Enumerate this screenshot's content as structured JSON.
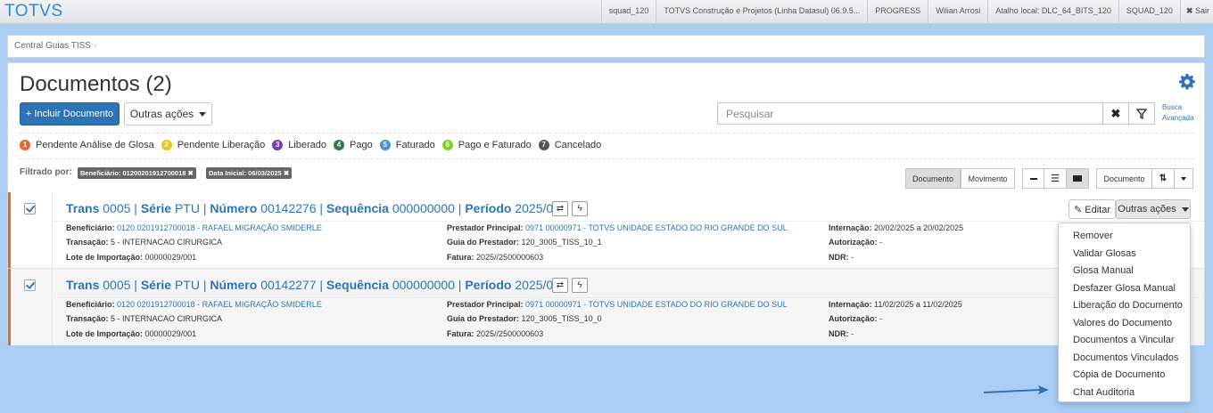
{
  "topbar": {
    "brand": "TOTVS",
    "items": [
      "squad_120",
      "TOTVS Construção e Projetos (Linha Datasul) 06.9.5...",
      "PROGRESS",
      "Wilian Arrosi",
      "Atalho local: DLC_64_BITS_120",
      "SQUAD_120"
    ],
    "exit": "Sair"
  },
  "breadcrumb": "Central Guias TISS",
  "page": {
    "title": "Documentos (2)",
    "add_button": "+ Incluir Documento",
    "other_actions": "Outras ações",
    "search_placeholder": "Pesquisar",
    "advanced_search_1": "Busca",
    "advanced_search_2": "Avançada"
  },
  "legend": [
    {
      "num": "1",
      "label": "Pendente Análise de Glosa",
      "color": "#e8642c"
    },
    {
      "num": "2",
      "label": "Pendente Liberação",
      "color": "#f0c419"
    },
    {
      "num": "3",
      "label": "Liberado",
      "color": "#7b3fa8"
    },
    {
      "num": "4",
      "label": "Pago",
      "color": "#2e7d4f"
    },
    {
      "num": "5",
      "label": "Faturado",
      "color": "#4a90e2"
    },
    {
      "num": "6",
      "label": "Pago e Faturado",
      "color": "#7ed321"
    },
    {
      "num": "7",
      "label": "Cancelado",
      "color": "#555555"
    }
  ],
  "filters": {
    "label": "Filtrado por:",
    "tags": [
      "Beneficiário: 01200201912700018",
      "Data Inicial: 06/03/2025"
    ]
  },
  "view": {
    "documento": "Documento",
    "movimento": "Movimento",
    "sort": "Documento"
  },
  "rows": [
    {
      "trans_k": "Trans",
      "trans_v": "0005",
      "serie_k": "Série",
      "serie_v": "PTU",
      "numero_k": "Número",
      "numero_v": "00142276",
      "seq_k": "Sequência",
      "seq_v": "000000000",
      "periodo_k": "Período",
      "periodo_v": "2025/003",
      "benef_k": "Beneficiário:",
      "benef_v": "0120 0201912700018 - RAFAEL MIGRAÇÃO SMIDERLE",
      "transacao_k": "Transação:",
      "transacao_v": "5 - INTERNACAO CIRURGICA",
      "lote_k": "Lote de Importação:",
      "lote_v": "00000029/001",
      "prest_k": "Prestador Principal:",
      "prest_v": "0971 00000971 - TOTVS UNIDADE ESTADO DO RIO GRANDE DO SUL",
      "guia_k": "Guia do Prestador:",
      "guia_v": "120_3005_TISS_10_1",
      "fatura_k": "Fatura:",
      "fatura_v": "2025//2500000603",
      "intern_k": "Internação:",
      "intern_v": "20/02/2025 a 20/02/2025",
      "autor_k": "Autorização:",
      "autor_v": "-",
      "ndr_k": "NDR:",
      "ndr_v": "-"
    },
    {
      "trans_k": "Trans",
      "trans_v": "0005",
      "serie_k": "Série",
      "serie_v": "PTU",
      "numero_k": "Número",
      "numero_v": "00142277",
      "seq_k": "Sequência",
      "seq_v": "000000000",
      "periodo_k": "Período",
      "periodo_v": "2025/003",
      "benef_k": "Beneficiário:",
      "benef_v": "0120 0201912700018 - RAFAEL MIGRAÇÃO SMIDERLE",
      "transacao_k": "Transação:",
      "transacao_v": "5 - INTERNACAO CIRURGICA",
      "lote_k": "Lote de Importação:",
      "lote_v": "00000029/001",
      "prest_k": "Prestador Principal:",
      "prest_v": "0971 00000971 - TOTVS UNIDADE ESTADO DO RIO GRANDE DO SUL",
      "guia_k": "Guia do Prestador:",
      "guia_v": "120_3005_TISS_10_0",
      "fatura_k": "Fatura:",
      "fatura_v": "2025//2500000603",
      "intern_k": "Internação:",
      "intern_v": "11/02/2025 a 11/02/2025",
      "autor_k": "Autorização:",
      "autor_v": "-",
      "ndr_k": "NDR:",
      "ndr_v": "-"
    }
  ],
  "row_actions": {
    "edit": "Editar",
    "more": "Outras ações"
  },
  "menu": [
    "Remover",
    "Validar Glosas",
    "Glosa Manual",
    "Desfazer Glosa Manual",
    "Liberação do Documento",
    "Valores do Documento",
    "Documentos a Vincular",
    "Documentos Vinculados",
    "Cópia de Documento",
    "Chat Auditoria"
  ]
}
